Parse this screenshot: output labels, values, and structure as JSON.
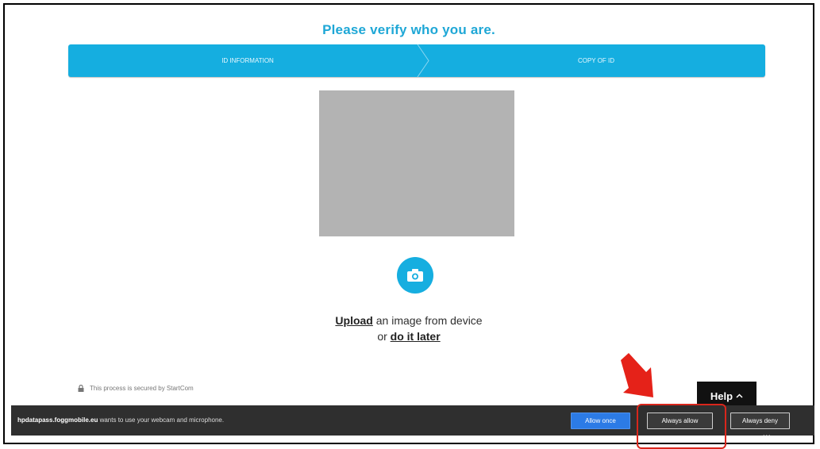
{
  "page": {
    "title": "Please verify who you are.",
    "steps": [
      "ID INFORMATION",
      "COPY OF ID"
    ],
    "upload": {
      "link_upload": "Upload",
      "text_after_upload": " an image from device",
      "text_or": "or ",
      "link_later": "do it later"
    },
    "secure_note": "This process is secured by StartCom",
    "help_label": "Help"
  },
  "permission_bar": {
    "site": "hpdatapass.foggmobile.eu",
    "message": " wants to use your webcam and microphone.",
    "buttons": {
      "allow_once": "Allow once",
      "always_allow": "Always allow",
      "always_deny": "Always deny"
    },
    "overflow": "..."
  },
  "icons": {
    "camera": "camera-icon",
    "lock": "lock-icon",
    "help_caret": "chevron-up-icon",
    "annotation_arrow": "red-arrow-icon"
  },
  "colors": {
    "accent": "#15aee0",
    "title": "#1ea7d6",
    "permission_bar": "#2f2f2f",
    "primary_button": "#2c7be6",
    "annotation": "#d9261c"
  }
}
